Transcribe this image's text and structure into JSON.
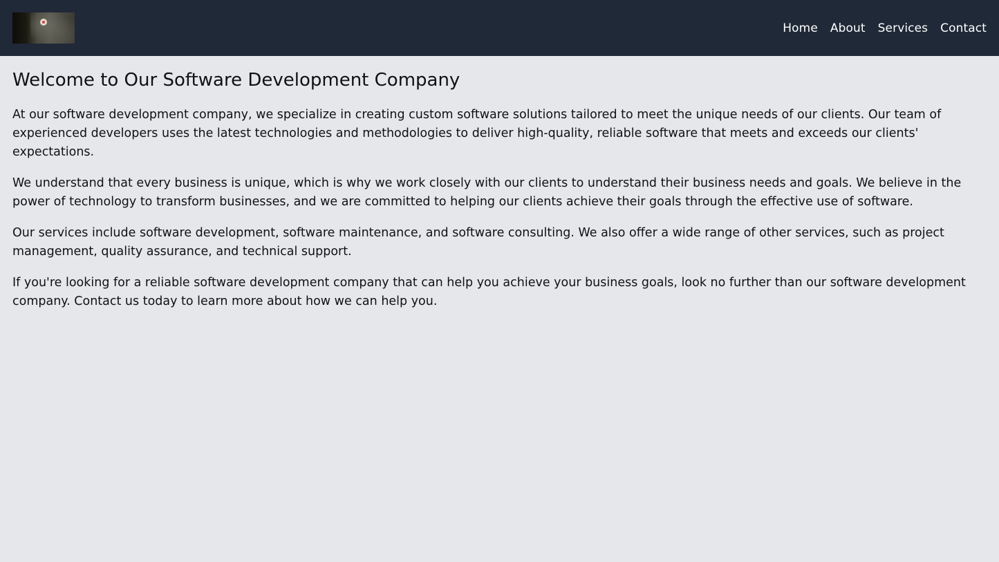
{
  "header": {
    "logo_alt": "Logo",
    "nav": [
      {
        "label": "Home"
      },
      {
        "label": "About"
      },
      {
        "label": "Services"
      },
      {
        "label": "Contact"
      }
    ],
    "background_color": "#1f2937"
  },
  "main": {
    "title": "Welcome to Our Software Development Company",
    "paragraphs": [
      "At our software development company, we specialize in creating custom software solutions tailored to meet the unique needs of our clients. Our team of experienced developers uses the latest technologies and methodologies to deliver high-quality, reliable software that meets and exceeds our clients' expectations.",
      "We understand that every business is unique, which is why we work closely with our clients to understand their business needs and goals. We believe in the power of technology to transform businesses, and we are committed to helping our clients achieve their goals through the effective use of software.",
      "Our services include software development, software maintenance, and software consulting. We also offer a wide range of other services, such as project management, quality assurance, and technical support.",
      "If you're looking for a reliable software development company that can help you achieve your business goals, look no further than our software development company. Contact us today to learn more about how we can help you."
    ],
    "background_color": "#e5e7eb"
  }
}
